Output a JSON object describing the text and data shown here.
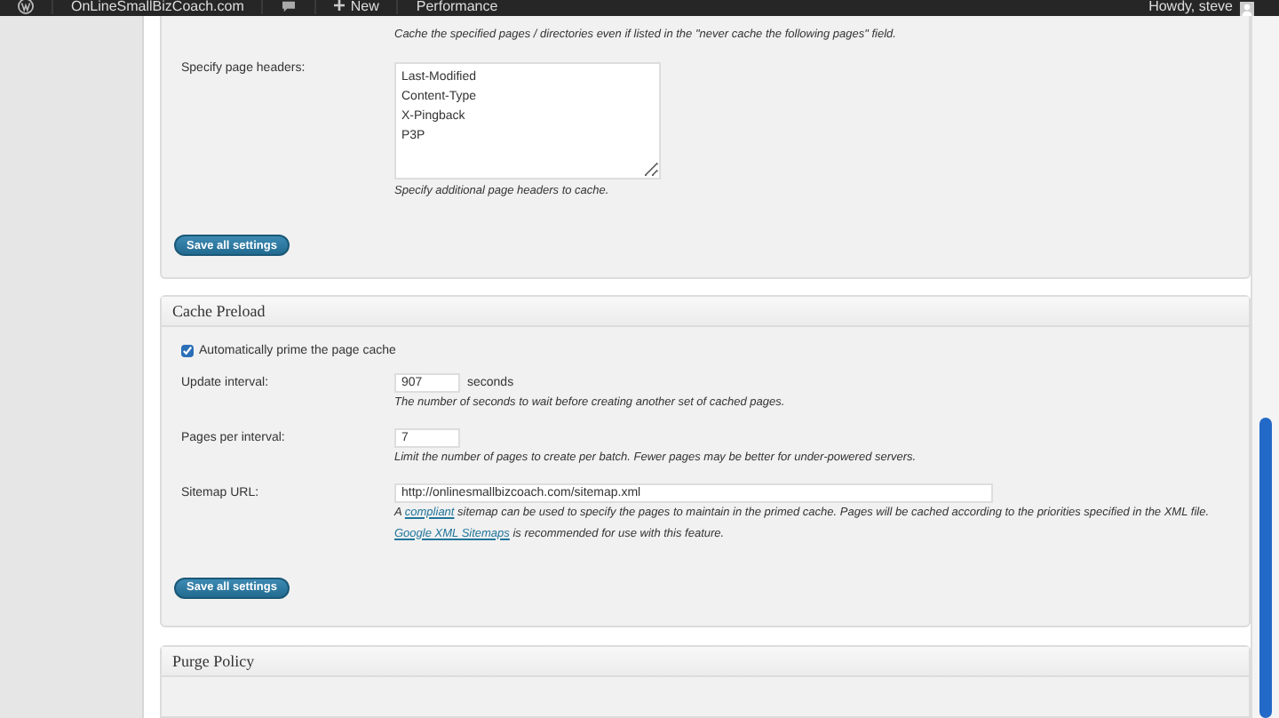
{
  "admin_bar": {
    "site": "OnLineSmallBizCoach.com",
    "new_label": "New",
    "menu": "Performance",
    "greeting": "Howdy, steve"
  },
  "cache_settings": {
    "top_note": "Cache the specified pages / directories even if listed in the \"never cache the following pages\" field.",
    "headers_label": "Specify page headers:",
    "headers_value": "Last-Modified\nContent-Type\nX-Pingback\nP3P",
    "headers_hint": "Specify additional page headers to cache.",
    "save_button": "Save all settings"
  },
  "cache_preload": {
    "title": "Cache Preload",
    "auto_prime": {
      "label": "Automatically prime the page cache",
      "checked": true
    },
    "fields": [
      {
        "kind": "short",
        "label": "Update interval:",
        "value": "907",
        "unit": "seconds",
        "hint": [
          [
            {
              "text": "The number of seconds to wait before creating another set of cached pages.",
              "kind": "text"
            }
          ]
        ]
      },
      {
        "kind": "short",
        "label": "Pages per interval:",
        "value": "7",
        "hint": [
          [
            {
              "text": "Limit the number of pages to create per batch. Fewer pages may be better for under-powered servers.",
              "kind": "text"
            }
          ]
        ]
      },
      {
        "kind": "long",
        "label": "Sitemap URL:",
        "value": "http://onlinesmallbizcoach.com/sitemap.xml",
        "hint": [
          [
            {
              "text": "A ",
              "kind": "text"
            },
            {
              "text": "compliant",
              "kind": "link"
            },
            {
              "text": " sitemap can be used to specify the pages to maintain in the primed cache. Pages will be cached according to the priorities specified in the XML file.",
              "kind": "text"
            }
          ],
          [
            {
              "text": "Google XML Sitemaps",
              "kind": "link"
            },
            {
              "text": " is recommended for use with this feature.",
              "kind": "text"
            }
          ]
        ]
      }
    ],
    "save_button": "Save all settings"
  },
  "purge_policy": {
    "title": "Purge Policy"
  }
}
